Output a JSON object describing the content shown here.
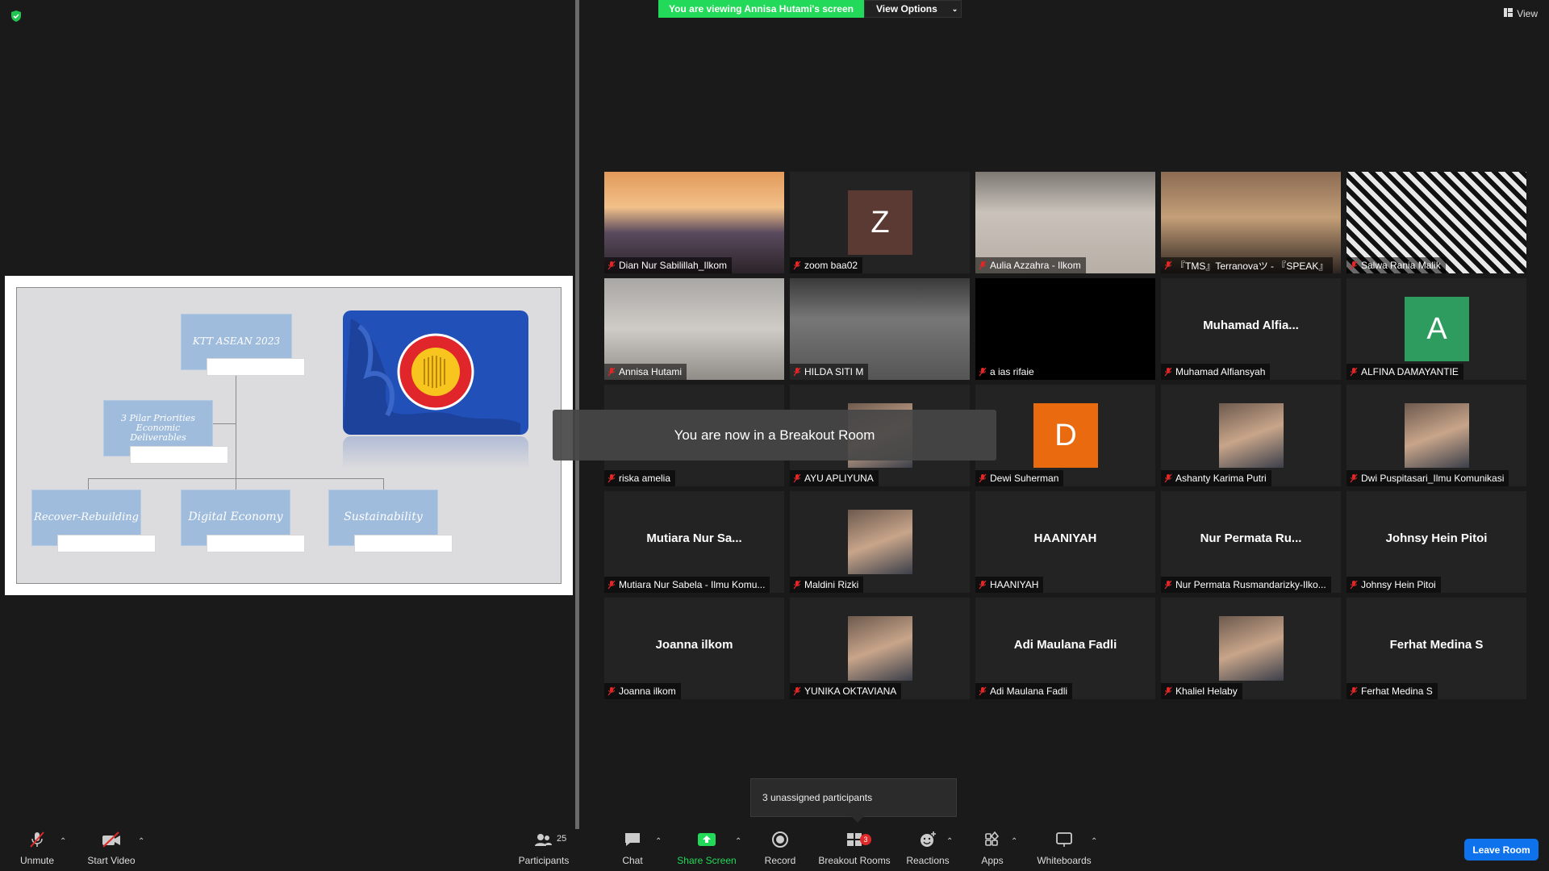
{
  "banner": {
    "viewing": "You are viewing Annisa Hutami's screen",
    "view_options": "View Options",
    "view": "View"
  },
  "slide": {
    "title_box": "KTT ASEAN 2023",
    "pillar_box": "3 Pilar Priorities Economic Deliverables",
    "boxes": [
      "Recover-Rebuilding",
      "Digital Economy",
      "Sustainability"
    ]
  },
  "toast": "You are now in a Breakout Room",
  "unassigned": "3 unassigned participants",
  "participants": [
    {
      "name": "Dian Nur Sabilillah_Ilkom",
      "kind": "video"
    },
    {
      "name": "zoom baa02",
      "kind": "avatar",
      "initial": "Z",
      "color": "#5b3a33"
    },
    {
      "name": "Aulia Azzahra - Ilkom",
      "kind": "video"
    },
    {
      "name": "『TMS』Terranovaツ - 『SPEAK』",
      "kind": "video"
    },
    {
      "name": "Salwa Rania Malik",
      "kind": "video"
    },
    {
      "name": "Annisa Hutami",
      "kind": "video",
      "active": true
    },
    {
      "name": "HILDA SITI M",
      "kind": "video"
    },
    {
      "name": "a ias rifaie",
      "kind": "video"
    },
    {
      "name": "Muhamad Alfiansyah",
      "kind": "text",
      "display": "Muhamad  Alfia..."
    },
    {
      "name": "ALFINA DAMAYANTIE",
      "kind": "avatar",
      "initial": "A",
      "color": "#2e9c5e"
    },
    {
      "name": "riska amelia",
      "kind": "blank"
    },
    {
      "name": "AYU APLIYUNA",
      "kind": "photo"
    },
    {
      "name": "Dewi Suherman",
      "kind": "avatar",
      "initial": "D",
      "color": "#ea6a10"
    },
    {
      "name": "Ashanty Karima Putri",
      "kind": "photo"
    },
    {
      "name": "Dwi Puspitasari_Ilmu Komunikasi",
      "kind": "photo"
    },
    {
      "name": "Mutiara Nur Sabela - Ilmu Komu...",
      "kind": "text",
      "display": "Mutiara  Nur  Sa..."
    },
    {
      "name": "Maldini Rizki",
      "kind": "photo"
    },
    {
      "name": "HAANIYAH",
      "kind": "text",
      "display": "HAANIYAH"
    },
    {
      "name": "Nur Permata Rusmandarizky-Ilko...",
      "kind": "text",
      "display": "Nur  Permata  Ru..."
    },
    {
      "name": "Johnsy Hein Pitoi",
      "kind": "text",
      "display": "Johnsy Hein Pitoi"
    },
    {
      "name": "Joanna ilkom",
      "kind": "text",
      "display": "Joanna ilkom"
    },
    {
      "name": "YUNIKA OKTAVIANA",
      "kind": "photo"
    },
    {
      "name": "Adi Maulana Fadli",
      "kind": "text",
      "display": "Adi Maulana Fadli"
    },
    {
      "name": "Khaliel Helaby",
      "kind": "photo"
    },
    {
      "name": "Ferhat Medina S",
      "kind": "text",
      "display": "Ferhat Medina S"
    }
  ],
  "toolbar": {
    "unmute": "Unmute",
    "start_video": "Start Video",
    "participants": "Participants",
    "participants_count": "25",
    "chat": "Chat",
    "share_screen": "Share Screen",
    "record": "Record",
    "breakout_rooms": "Breakout Rooms",
    "breakout_badge": "3",
    "reactions": "Reactions",
    "apps": "Apps",
    "whiteboards": "Whiteboards",
    "leave": "Leave Room"
  },
  "colors": {
    "share_green": "#23d959",
    "leave_blue": "#0e72ed",
    "active_outline": "#d7e86a"
  }
}
